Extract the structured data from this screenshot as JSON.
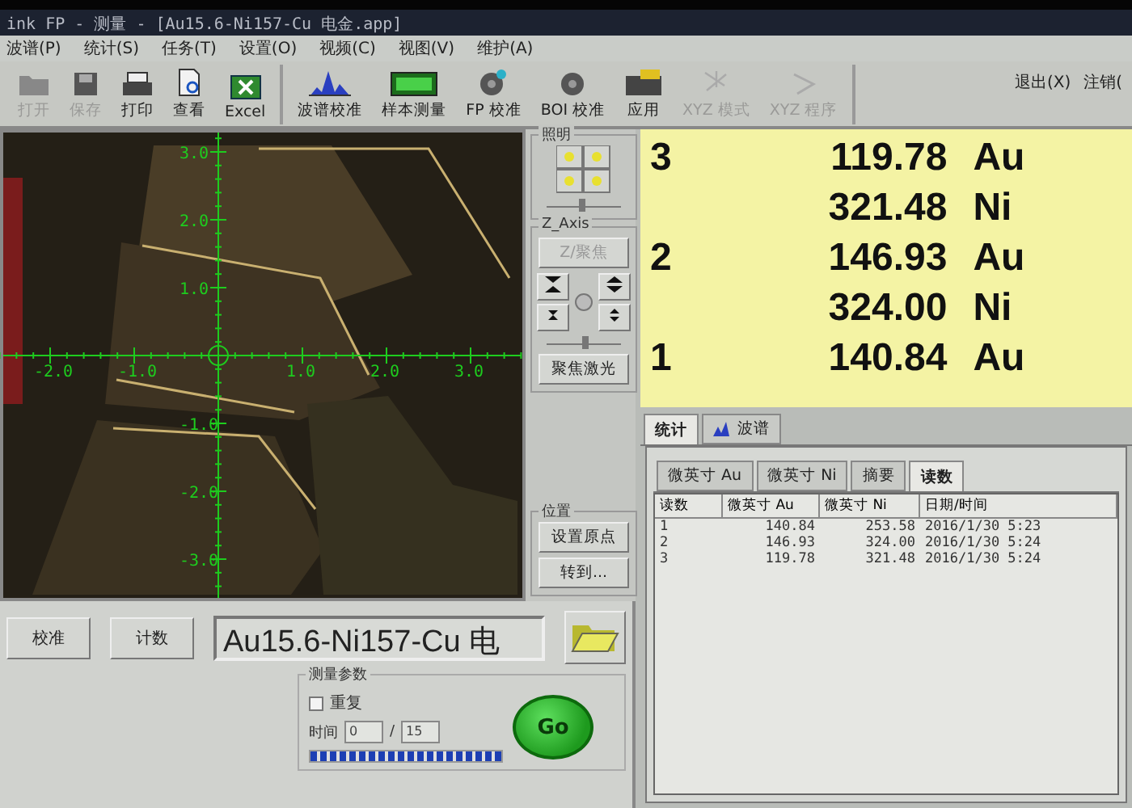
{
  "window": {
    "title": "ink FP - 测量 - [Au15.6-Ni157-Cu 电金.app]"
  },
  "menu": [
    "波谱(P)",
    "统计(S)",
    "任务(T)",
    "设置(O)",
    "视频(C)",
    "视图(V)",
    "维护(A)"
  ],
  "toolbar": [
    {
      "label": "打开",
      "disabled": true
    },
    {
      "label": "保存",
      "disabled": true
    },
    {
      "label": "打印",
      "disabled": false
    },
    {
      "label": "查看",
      "disabled": false
    },
    {
      "label": "Excel",
      "disabled": false
    },
    {
      "label": "波谱校准",
      "disabled": false
    },
    {
      "label": "样本测量",
      "disabled": false
    },
    {
      "label": "FP 校准",
      "disabled": false
    },
    {
      "label": "BOI 校准",
      "disabled": false
    },
    {
      "label": "应用",
      "disabled": false
    },
    {
      "label": "XYZ 模式",
      "disabled": true
    },
    {
      "label": "XYZ 程序",
      "disabled": true
    }
  ],
  "session": [
    "退出(X)",
    "注销("
  ],
  "video": {
    "x_labels": [
      "-2.0",
      "-1.0",
      "1.0",
      "2.0",
      "3.0"
    ],
    "y_labels": [
      "3.0",
      "2.0",
      "1.0",
      "-1.0",
      "-2.0",
      "-3.0"
    ]
  },
  "controls": {
    "lighting_title": "照明",
    "z_axis_title": "Z_Axis",
    "z_focus_button": {
      "label": "Z/聚焦",
      "disabled": true
    },
    "laser_button": "聚焦激光",
    "position_title": "位置",
    "origin_button": "设置原点",
    "goto_button": "转到..."
  },
  "readings": [
    {
      "number": "3",
      "value": "119.78",
      "element": "Au"
    },
    {
      "value": "321.48",
      "element": "Ni"
    },
    {
      "number": "2",
      "value": "146.93",
      "element": "Au"
    },
    {
      "value": "324.00",
      "element": "Ni"
    },
    {
      "number": "1",
      "value": "140.84",
      "element": "Au"
    }
  ],
  "tabs": [
    {
      "label": "统计",
      "selected": true
    },
    {
      "label": "波谱",
      "selected": false
    }
  ],
  "subtabs": [
    {
      "label": "微英寸 Au",
      "selected": false
    },
    {
      "label": "微英寸 Ni",
      "selected": false
    },
    {
      "label": "摘要",
      "selected": false
    },
    {
      "label": "读数",
      "selected": true
    }
  ],
  "table": {
    "columns": [
      "读数",
      "微英寸 Au",
      "微英寸 Ni",
      "日期/时间"
    ],
    "rows": [
      [
        "1",
        "140.84",
        "253.58",
        "2016/1/30 5:23"
      ],
      [
        "2",
        "146.93",
        "324.00",
        "2016/1/30 5:24"
      ],
      [
        "3",
        "119.78",
        "321.48",
        "2016/1/30 5:24"
      ]
    ]
  },
  "bottom": {
    "buttons": [
      "校准",
      "计数"
    ],
    "file": "Au15.6-Ni157-Cu 电"
  },
  "measure": {
    "title": "测量参数",
    "repeat": {
      "label": "重复",
      "checked": false
    },
    "time_label": "时间",
    "time_value": "0",
    "separator": "/",
    "time_total": "15",
    "level": 1,
    "go": "Go"
  }
}
